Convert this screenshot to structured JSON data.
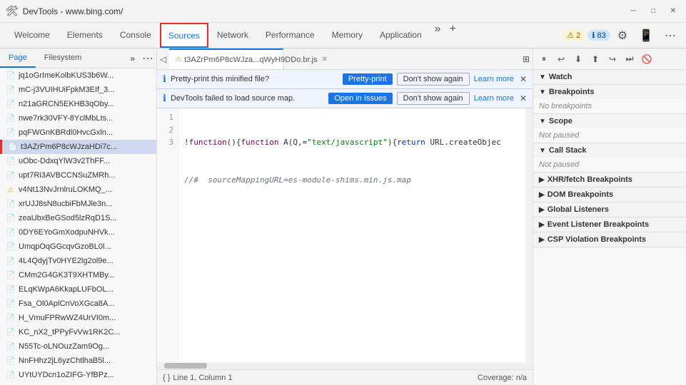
{
  "titleBar": {
    "icon": "🌐",
    "title": "DevTools - www.bing.com/",
    "controls": {
      "minimize": "─",
      "maximize": "□",
      "close": "✕"
    }
  },
  "mainTabs": {
    "items": [
      {
        "id": "welcome",
        "label": "Welcome"
      },
      {
        "id": "elements",
        "label": "Elements"
      },
      {
        "id": "console",
        "label": "Console"
      },
      {
        "id": "sources",
        "label": "Sources",
        "active": true
      },
      {
        "id": "network",
        "label": "Network"
      },
      {
        "id": "performance",
        "label": "Performance"
      },
      {
        "id": "memory",
        "label": "Memory"
      },
      {
        "id": "application",
        "label": "Application"
      }
    ],
    "overflow": "»",
    "add": "+",
    "badges": {
      "warning": {
        "count": "2",
        "icon": "⚠"
      },
      "info": {
        "count": "83",
        "icon": "ℹ"
      }
    },
    "settingsIcon": "⚙",
    "deviceIcon": "📱",
    "moreIcon": "⋯"
  },
  "sidebar": {
    "tabs": [
      {
        "id": "page",
        "label": "Page",
        "active": true
      },
      {
        "id": "filesystem",
        "label": "Filesystem"
      }
    ],
    "moreLabel": "»",
    "optionsLabel": "⋯",
    "files": [
      {
        "id": "f1",
        "name": "jq1oGrImeKolbKUS3b6W...",
        "icon": "📄",
        "warn": false
      },
      {
        "id": "f2",
        "name": "mC-j3VUIHUiFpkM3EIf_3...",
        "icon": "📄",
        "warn": false
      },
      {
        "id": "f3",
        "name": "n21aGRCN5EKHB3qOby...",
        "icon": "📄",
        "warn": false
      },
      {
        "id": "f4",
        "name": "nwe7rk30VFY-8YclMbLts...",
        "icon": "📄",
        "warn": false
      },
      {
        "id": "f5",
        "name": "pqFWGnKBRdl0HvcGxln...",
        "icon": "📄",
        "warn": false
      },
      {
        "id": "f6",
        "name": "t3AZrPm6P8cWJzaHDi7c...",
        "icon": "📄",
        "warn": false,
        "selected": true
      },
      {
        "id": "f7",
        "name": "uObc-DdxqYlW3v2ThFF...",
        "icon": "📄",
        "warn": false
      },
      {
        "id": "f8",
        "name": "upt7Ri3AVBCCNSuZMRh...",
        "icon": "📄",
        "warn": false
      },
      {
        "id": "f9",
        "name": "v4Nt13NvJrnlruLOKMQ_...",
        "icon": "⚠",
        "warn": true
      },
      {
        "id": "f10",
        "name": "xrUJJ8sN8ucbiFbMJle3n...",
        "icon": "📄",
        "warn": false
      },
      {
        "id": "f11",
        "name": "zeaUbxBeGSod5lzRqD1S...",
        "icon": "📄",
        "warn": false
      },
      {
        "id": "f12",
        "name": "0DY6EYoGmXodpuNHVk...",
        "icon": "📄",
        "warn": false
      },
      {
        "id": "f13",
        "name": "UmqpOqGGcqvGzoBL0l...",
        "icon": "📄",
        "warn": false
      },
      {
        "id": "f14",
        "name": "4L4QdyjTv0HYE2lg2ol9e...",
        "icon": "📄",
        "warn": false
      },
      {
        "id": "f15",
        "name": "CMm2G4GK3T9XHTMBy...",
        "icon": "📄",
        "warn": false
      },
      {
        "id": "f16",
        "name": "ELqKWpA6KkapLUFbOL...",
        "icon": "📄",
        "warn": false
      },
      {
        "id": "f17",
        "name": "Fsa_Ol0AplCnVoXGca8A...",
        "icon": "📄",
        "warn": false
      },
      {
        "id": "f18",
        "name": "H_VmuFPRwWZ4UrVI0m...",
        "icon": "📄",
        "warn": false
      },
      {
        "id": "f19",
        "name": "KC_nX2_tPPyFvVw1RK2C...",
        "icon": "📄",
        "warn": false
      },
      {
        "id": "f20",
        "name": "N55Tc-oLNOuzZam9Og...",
        "icon": "📄",
        "warn": false
      },
      {
        "id": "f21",
        "name": "NnFHhz2jL6yzChtlhaB5l...",
        "icon": "📄",
        "warn": false
      },
      {
        "id": "f22",
        "name": "UYtUYDcn1oZIFG-YfBPz...",
        "icon": "📄",
        "warn": false
      }
    ]
  },
  "fileTab": {
    "name": "t3AZrPm6P8cWJza...qWyH9DDo.br.js",
    "warn": true
  },
  "notifications": {
    "prettyPrint": {
      "infoIcon": "ℹ",
      "text": "Pretty-print this minified file?",
      "prettyPrintBtn": "Pretty-print",
      "dontShowBtn": "Don't show again",
      "learnMore": "Learn more",
      "closeIcon": "✕"
    },
    "sourceMap": {
      "infoIcon": "ℹ",
      "text": "DevTools failed to load source map.",
      "openInIssuesBtn": "Open in Issues",
      "dontShowBtn": "Don't show again",
      "learnMore": "Learn more",
      "closeIcon": "✕"
    }
  },
  "codeEditor": {
    "lines": [
      {
        "num": "1",
        "content": "!function(){function A(Q,=\"text/javascript\"){return URL.createObjec"
      },
      {
        "num": "2",
        "content": ""
      },
      {
        "num": "3",
        "content": "//#  sourceMappingURL=es-module-shims.min.js.map"
      }
    ],
    "statusBar": {
      "braces": "{ }",
      "position": "Line 1, Column 1",
      "coverage": "Coverage: n/a"
    }
  },
  "rightSidebar": {
    "icons": [
      "⏸",
      "↩",
      "⬇",
      "⬆",
      "↪",
      "⏭",
      "🚫"
    ],
    "sections": [
      {
        "id": "watch",
        "label": "Watch",
        "expanded": true,
        "content": null
      },
      {
        "id": "breakpoints",
        "label": "Breakpoints",
        "expanded": true,
        "content": "No breakpoints"
      },
      {
        "id": "scope",
        "label": "Scope",
        "expanded": true,
        "content": "Not paused"
      },
      {
        "id": "call-stack",
        "label": "Call Stack",
        "expanded": true,
        "content": "Not paused"
      },
      {
        "id": "xhr-fetch",
        "label": "XHR/fetch Breakpoints",
        "expanded": false,
        "content": null
      },
      {
        "id": "dom-breakpoints",
        "label": "DOM Breakpoints",
        "expanded": false,
        "content": null
      },
      {
        "id": "global-listeners",
        "label": "Global Listeners",
        "expanded": false,
        "content": null
      },
      {
        "id": "event-listeners",
        "label": "Event Listener Breakpoints",
        "expanded": false,
        "content": null
      },
      {
        "id": "csp-violation",
        "label": "CSP Violation Breakpoints",
        "expanded": false,
        "content": null
      }
    ]
  }
}
